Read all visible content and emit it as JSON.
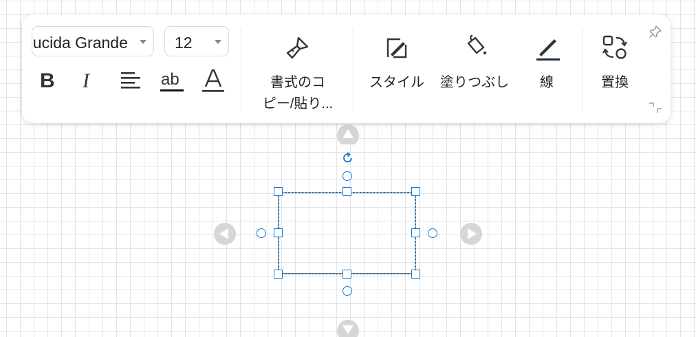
{
  "toolbar": {
    "font_family": "Lucida Grande",
    "font_size": "12",
    "copy_format_label": "書式のコピー/貼り...",
    "copy_format_line1": "書式のコ",
    "copy_format_line2": "ピー/貼り...",
    "style_label": "スタイル",
    "fill_label": "塗りつぶし",
    "line_label": "線",
    "replace_label": "置換",
    "bold_glyph": "B",
    "italic_glyph": "I"
  },
  "colors": {
    "selection": "#0a7ad8",
    "grid": "#e4e4e4",
    "arrow": "#d6d6d6",
    "line_underline": "#1a2a44"
  },
  "icons": [
    "chevron-down-icon",
    "bold-icon",
    "italic-icon",
    "align-left-icon",
    "strikethrough-icon",
    "font-color-icon",
    "format-painter-icon",
    "style-icon",
    "fill-bucket-icon",
    "line-pen-icon",
    "replace-icon",
    "pin-icon",
    "resize-corner-icon",
    "rotate-icon",
    "arrow-up-icon",
    "arrow-down-icon",
    "arrow-left-icon",
    "arrow-right-icon"
  ]
}
